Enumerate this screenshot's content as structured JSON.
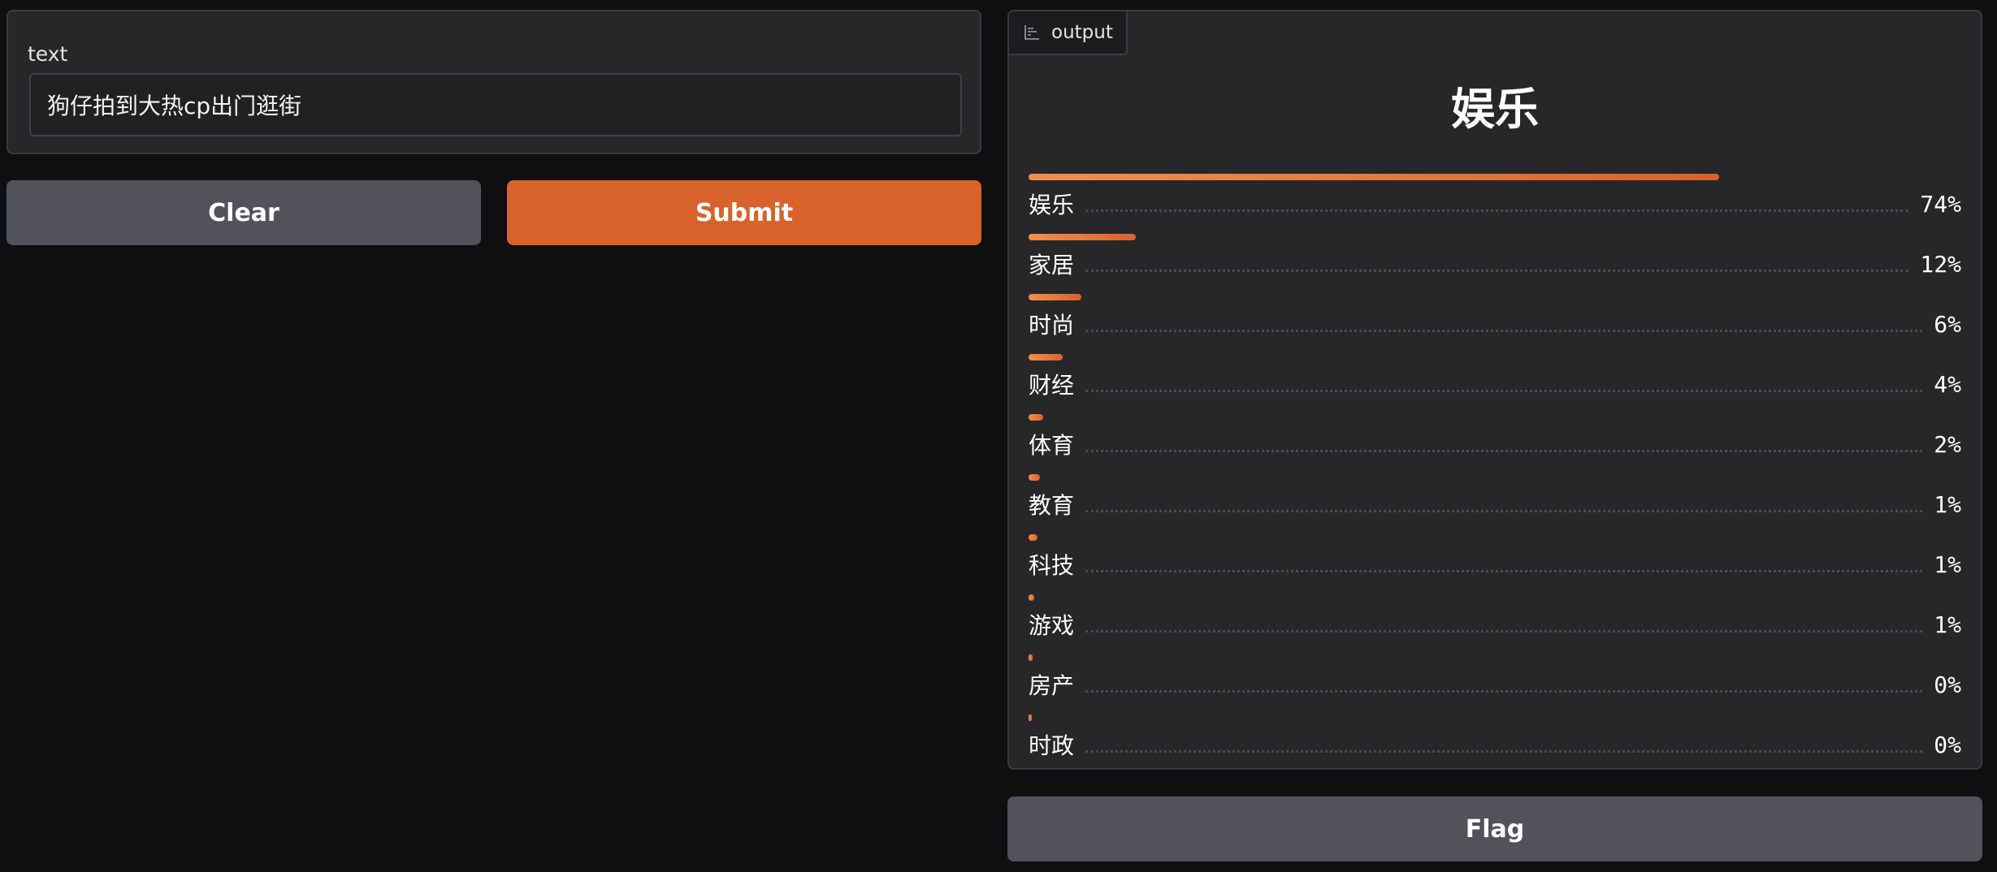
{
  "input": {
    "label": "text",
    "value": "狗仔拍到大热cp出门逛街"
  },
  "buttons": {
    "clear": "Clear",
    "submit": "Submit",
    "flag": "Flag"
  },
  "output": {
    "tab_label": "output",
    "tab_icon": "bar-chart-icon",
    "top_label": "娱乐",
    "accent_color": "#d9622b",
    "confidences": [
      {
        "label": "娱乐",
        "percent": "74%",
        "value": 0.74
      },
      {
        "label": "家居",
        "percent": "12%",
        "value": 0.115
      },
      {
        "label": "时尚",
        "percent": "6%",
        "value": 0.057
      },
      {
        "label": "财经",
        "percent": "4%",
        "value": 0.037
      },
      {
        "label": "体育",
        "percent": "2%",
        "value": 0.016
      },
      {
        "label": "教育",
        "percent": "1%",
        "value": 0.012
      },
      {
        "label": "科技",
        "percent": "1%",
        "value": 0.01
      },
      {
        "label": "游戏",
        "percent": "1%",
        "value": 0.006
      },
      {
        "label": "房产",
        "percent": "0%",
        "value": 0.004
      },
      {
        "label": "时政",
        "percent": "0%",
        "value": 0.003
      }
    ]
  }
}
